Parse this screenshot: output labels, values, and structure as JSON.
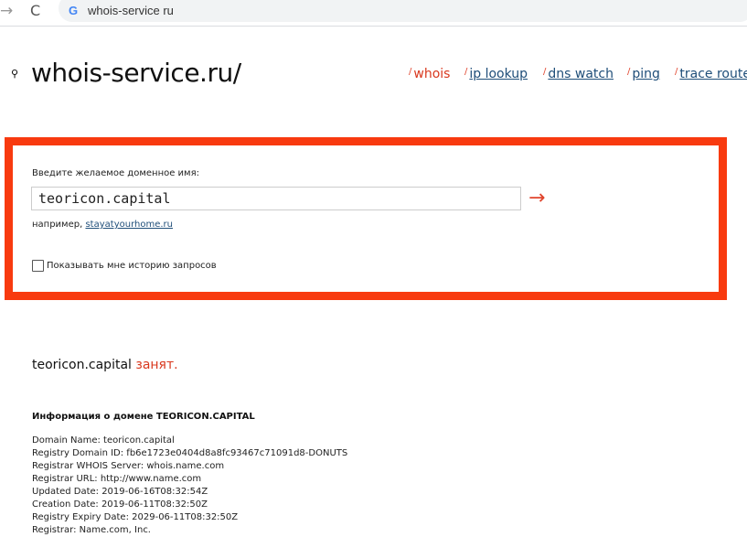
{
  "browser": {
    "url": "whois-service ru"
  },
  "site": {
    "logo": "whois-service.ru/"
  },
  "nav": [
    {
      "label": "whois",
      "active": true
    },
    {
      "label": "ip lookup"
    },
    {
      "label": "dns watch"
    },
    {
      "label": "ping"
    },
    {
      "label": "trace route"
    }
  ],
  "form": {
    "label": "Введите желаемое доменное имя:",
    "value": "teoricon.capital",
    "example_prefix": "например,",
    "example_link": "stayatyourhome.ru",
    "history_label": "Показывать мне историю запросов",
    "submit": "→"
  },
  "result": {
    "domain": "teoricon.capital",
    "status": "занят.",
    "info_title": "Информация о домене TEORICON.CAPITAL",
    "records": [
      "Domain Name: teoricon.capital",
      "Registry Domain ID: fb6e1723e0404d8a8fc93467c71091d8-DONUTS",
      "Registrar WHOIS Server: whois.name.com",
      "Registrar URL: http://www.name.com",
      "Updated Date: 2019-06-16T08:32:54Z",
      "Creation Date: 2019-06-11T08:32:50Z",
      "Registry Expiry Date: 2029-06-11T08:32:50Z",
      "Registrar: Name.com, Inc."
    ]
  },
  "colors": {
    "accent": "#f83a0f",
    "link": "#1f4e79"
  }
}
